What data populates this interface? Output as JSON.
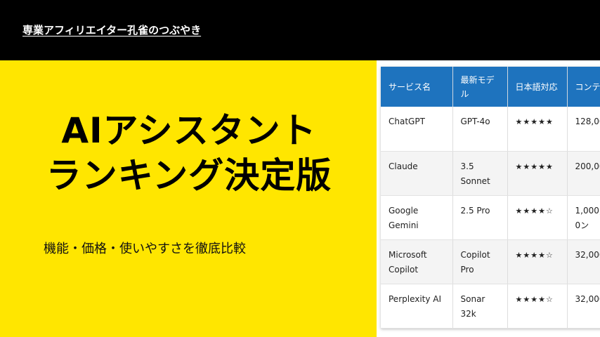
{
  "header": {
    "site_name": "専業アフィリエイター孔雀のつぶやき"
  },
  "hero": {
    "headline_line1": "AIアシスタント",
    "headline_line2": "ランキング決定版",
    "subtitle": "機能・価格・使いやすさを徹底比較"
  },
  "table": {
    "headers": [
      "サービス名",
      "最新モデル",
      "日本語対応",
      "コンテ"
    ],
    "rows": [
      {
        "service": "ChatGPT",
        "model": "GPT-4o",
        "japanese": "★★★★★",
        "context": "128,00"
      },
      {
        "service": "Claude",
        "model": "3.5 Sonnet",
        "japanese": "★★★★★",
        "context": "200,00"
      },
      {
        "service": "Google Gemini",
        "model": "2.5 Pro",
        "japanese": "★★★★☆",
        "context": "1,000,0ン"
      },
      {
        "service": "Microsoft Copilot",
        "model": "Copilot Pro",
        "japanese": "★★★★☆",
        "context": "32,000"
      },
      {
        "service": "Perplexity AI",
        "model": "Sonar 32k",
        "japanese": "★★★★☆",
        "context": "32,000"
      }
    ]
  },
  "colors": {
    "background": "#ffe600",
    "top_bar": "#000000",
    "table_header": "#1e73be"
  }
}
